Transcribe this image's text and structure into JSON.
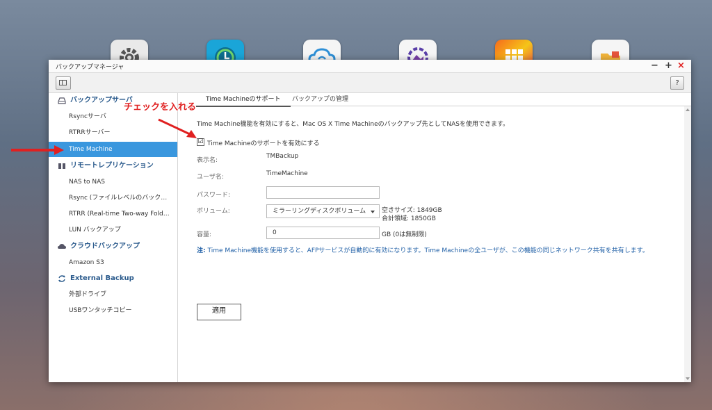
{
  "desktop": {
    "dock_icons": [
      {
        "name": "settings-gear-icon",
        "bg": "#e8e8e8"
      },
      {
        "name": "backup-clock-icon",
        "bg": "#19a3d6"
      },
      {
        "name": "cloud-sync-icon",
        "bg": "#f4f4f4"
      },
      {
        "name": "photo-station-icon",
        "bg": "#f4f4f4"
      },
      {
        "name": "app-center-grid-icon",
        "bg": "#f5a623"
      },
      {
        "name": "file-station-folder-icon",
        "bg": "#f4f4f4"
      }
    ]
  },
  "window": {
    "title": "バックアップマネージャ",
    "controls": {
      "minimize": "−",
      "maximize": "+",
      "close": "×"
    },
    "help_label": "?"
  },
  "sidebar": {
    "categories": [
      {
        "label": "バックアップサーバ",
        "icon": "hard-disk-icon"
      },
      {
        "label": "リモートレプリケーション",
        "icon": "replication-icon"
      },
      {
        "label": "クラウドバックアップ",
        "icon": "cloud-icon"
      },
      {
        "label": "External Backup",
        "icon": "sync-arrows-icon"
      }
    ],
    "items": [
      {
        "label": "Rsyncサーバ"
      },
      {
        "label": "RTRRサーバー"
      },
      {
        "label": "Time Machine"
      },
      {
        "label": "NAS to NAS"
      },
      {
        "label": "Rsync (ファイルレベルのバックアップ)"
      },
      {
        "label": "RTRR (Real-time Two-way Folder Sync)"
      },
      {
        "label": "LUN バックアップ"
      },
      {
        "label": "Amazon S3"
      },
      {
        "label": "外部ドライブ"
      },
      {
        "label": "USBワンタッチコピー"
      }
    ],
    "selected": "Time Machine"
  },
  "tabs": [
    {
      "label": "Time Machineのサポート"
    },
    {
      "label": "バックアップの管理"
    }
  ],
  "form": {
    "description": "Time Machine機能を有効にすると、Mac OS X Time Machineのバックアップ先としてNASを使用できます。",
    "enable_label": "Time Machineのサポートを有効にする",
    "enable_checked": "☑",
    "display_name_label": "表示名:",
    "display_name_value": "TMBackup",
    "username_label": "ユーザ名:",
    "username_value": "TimeMachine",
    "password_label": "パスワード:",
    "password_value": "",
    "volume_label": "ボリューム:",
    "volume_value": "ミラーリングディスクボリューム",
    "free_size": "空きサイズ: 1849GB",
    "total_area": "合計領域: 1850GB",
    "capacity_label": "容量:",
    "capacity_value": "0",
    "capacity_unit": "GB (0は無制限)",
    "note_prefix": "注:",
    "note_text": " Time Machine機能を使用すると、AFPサービスが自動的に有効になります。Time Machineの全ユーザが、この機能の同じネットワーク共有を共有します。",
    "apply_label": "適用"
  },
  "annotation": {
    "text": "チェックを入れる",
    "color": "#e02020"
  }
}
